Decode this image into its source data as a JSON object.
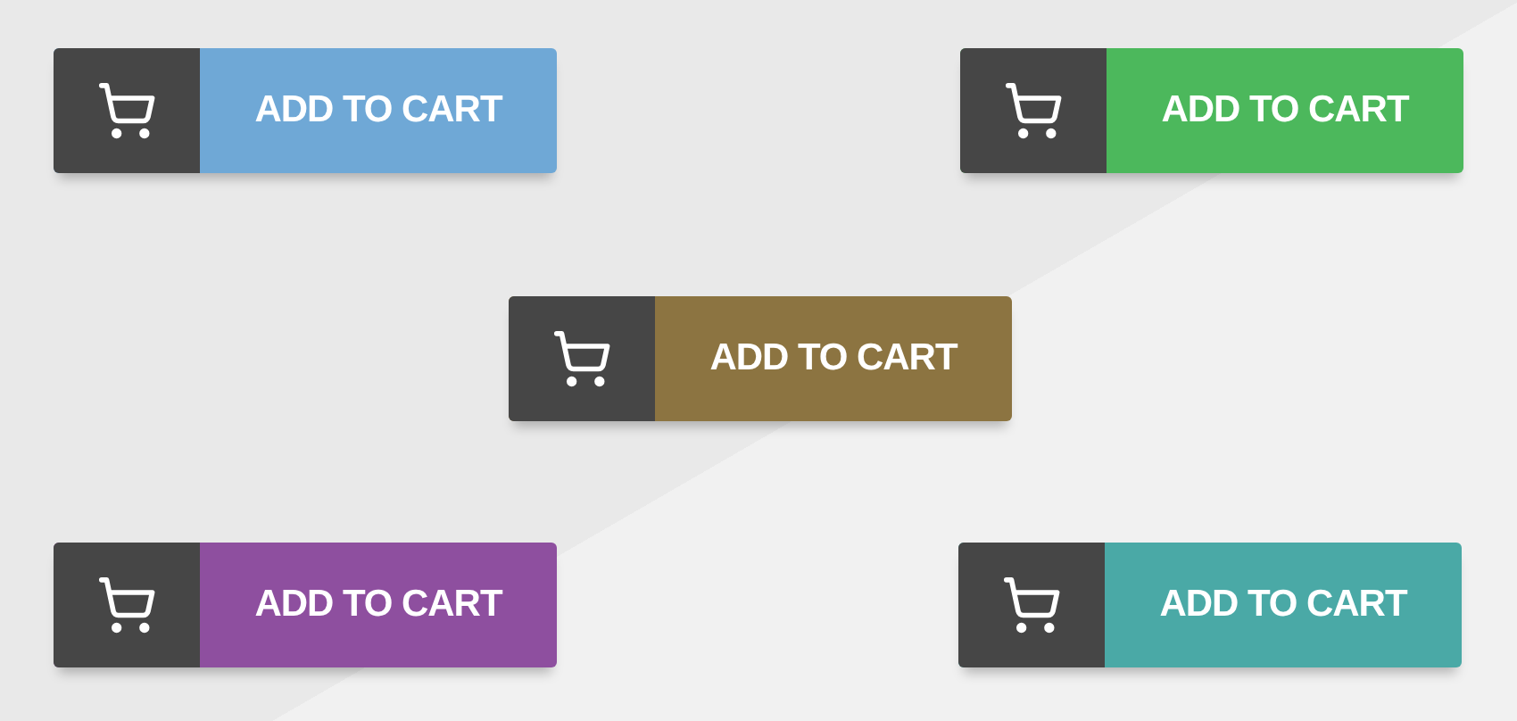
{
  "buttons": [
    {
      "label": "ADD TO CART",
      "color": "#6fa8d6"
    },
    {
      "label": "ADD TO CART",
      "color": "#4cb85c"
    },
    {
      "label": "ADD TO CART",
      "color": "#8c7441"
    },
    {
      "label": "ADD TO CART",
      "color": "#8e4f9f"
    },
    {
      "label": "ADD TO CART",
      "color": "#4aa9a6"
    }
  ]
}
